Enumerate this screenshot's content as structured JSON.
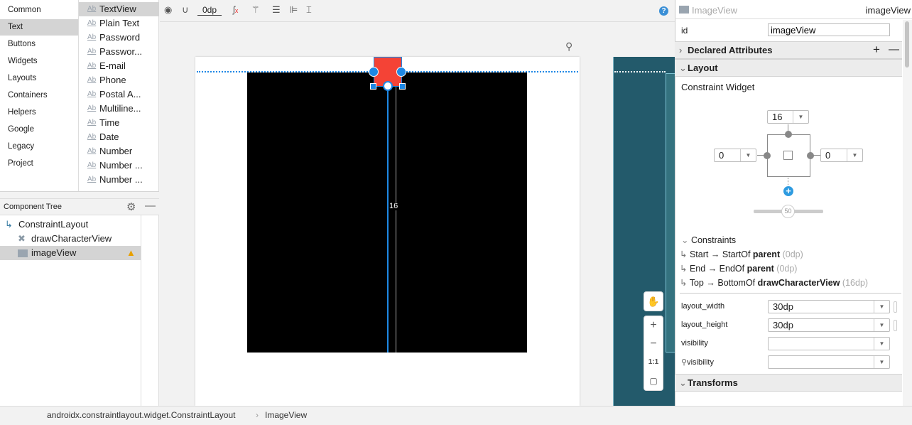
{
  "palette": {
    "categories": [
      "Common",
      "Text",
      "Buttons",
      "Widgets",
      "Layouts",
      "Containers",
      "Helpers",
      "Google",
      "Legacy",
      "Project"
    ],
    "selected_category": "Text",
    "items": [
      "TextView",
      "Plain Text",
      "Password",
      "Passwor...",
      "E-mail",
      "Phone",
      "Postal A...",
      "Multiline...",
      "Time",
      "Date",
      "Number",
      "Number ...",
      "Number ..."
    ],
    "item_icon": "Ab"
  },
  "component_tree": {
    "title": "Component Tree",
    "items": [
      {
        "label": "ConstraintLayout",
        "icon": "constraint-layout-icon"
      },
      {
        "label": "drawCharacterView",
        "icon": "custom-view-icon"
      },
      {
        "label": "imageView",
        "icon": "image-icon",
        "warning": true
      }
    ]
  },
  "toolbar": {
    "margin": "0dp"
  },
  "canvas": {
    "margin_label": "16",
    "colors": {
      "selection": "#1e88e5",
      "image_view": "#f44336",
      "blueprint": "#235a6b"
    }
  },
  "zoom_controls": {
    "zoom_in": "+",
    "zoom_out": "−",
    "actual_size": "1:1"
  },
  "status_bar": {
    "breadcrumb": [
      "androidx.constraintlayout.widget.ConstraintLayout",
      "ImageView"
    ]
  },
  "attributes": {
    "component_type": "ImageView",
    "component_id": "imageView",
    "id_label": "id",
    "id_value": "imageView",
    "declared_attributes": "Declared Attributes",
    "layout_section": "Layout",
    "constraint_widget": "Constraint Widget",
    "margins": {
      "top": "16",
      "start": "0",
      "end": "0"
    },
    "bias": "50",
    "constraints_title": "Constraints",
    "constraints": [
      {
        "from": "Start",
        "to": "StartOf",
        "target": "parent",
        "margin": "(0dp)"
      },
      {
        "from": "End",
        "to": "EndOf",
        "target": "parent",
        "margin": "(0dp)"
      },
      {
        "from": "Top",
        "to": "BottomOf",
        "target": "drawCharacterView",
        "margin": "(16dp)"
      }
    ],
    "arrow": "→",
    "fields": [
      {
        "label": "layout_width",
        "value": "30dp"
      },
      {
        "label": "layout_height",
        "value": "30dp"
      },
      {
        "label": "visibility",
        "value": ""
      },
      {
        "label": "visibility",
        "value": ""
      }
    ],
    "transforms": "Transforms"
  }
}
